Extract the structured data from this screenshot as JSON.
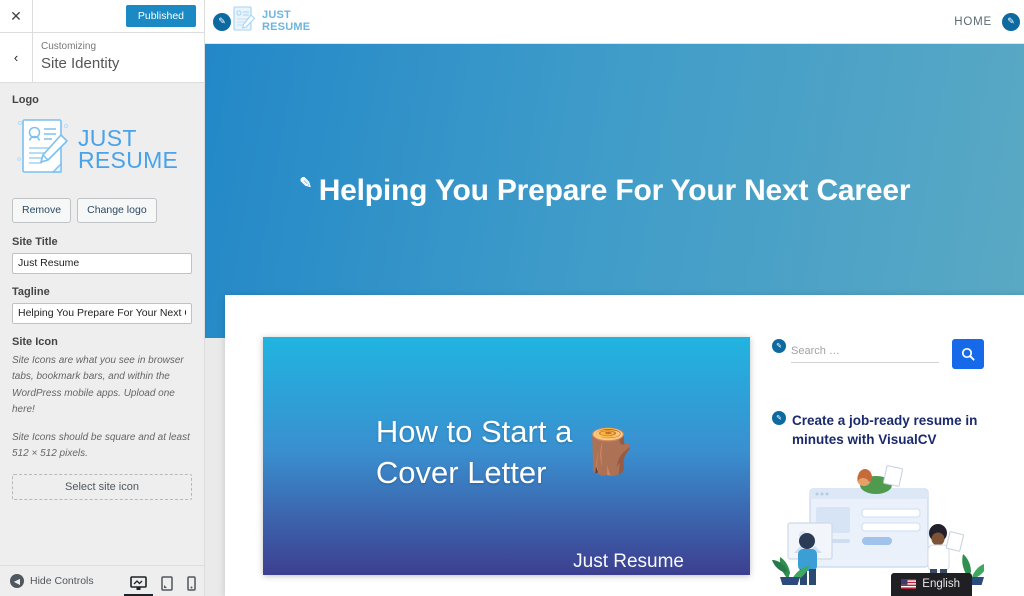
{
  "customizer": {
    "close_label": "✕",
    "publish_label": "Published",
    "back_label": "‹",
    "breadcrumb": "Customizing",
    "panel_title": "Site Identity",
    "logo_label": "Logo",
    "logo_text_line1": "JUST",
    "logo_text_line2": "RESUME",
    "remove_label": "Remove",
    "change_logo_label": "Change logo",
    "site_title_label": "Site Title",
    "site_title_value": "Just Resume",
    "tagline_label": "Tagline",
    "tagline_value": "Helping You Prepare For Your Next Career",
    "site_icon_label": "Site Icon",
    "site_icon_desc_1": "Site Icons are what you see in browser tabs, bookmark bars, and within the WordPress mobile apps. Upload one here!",
    "site_icon_desc_2": "Site Icons should be square and at least 512 × 512 pixels.",
    "select_icon_label": "Select site icon",
    "hide_controls_label": "Hide Controls",
    "devices": [
      {
        "name": "desktop",
        "active": true
      },
      {
        "name": "tablet",
        "active": false
      },
      {
        "name": "mobile",
        "active": false
      }
    ],
    "accent_color": "#1a89c4"
  },
  "preview": {
    "header": {
      "logo_line1": "JUST",
      "logo_line2": "RESUME",
      "nav": [
        "HOME"
      ]
    },
    "hero": {
      "headline": "Helping You Prepare For Your Next Career",
      "gradient_from": "#2388c8",
      "gradient_to": "#5aa9c4"
    },
    "post": {
      "title_line1": "How to Start a",
      "title_line2": "Cover Letter",
      "emoji": "🪵",
      "footer": "Just Resume",
      "gradient_from": "#21b4e0",
      "gradient_to": "#3d3f90"
    },
    "sidebar": {
      "search_placeholder": "Search …",
      "search_value": "",
      "search_icon": "search-icon",
      "search_button_color": "#1669e8",
      "promo_heading": "Create a job-ready resume in minutes with VisualCV",
      "promo_color": "#1a2a6c"
    },
    "language": {
      "label": "English"
    }
  }
}
